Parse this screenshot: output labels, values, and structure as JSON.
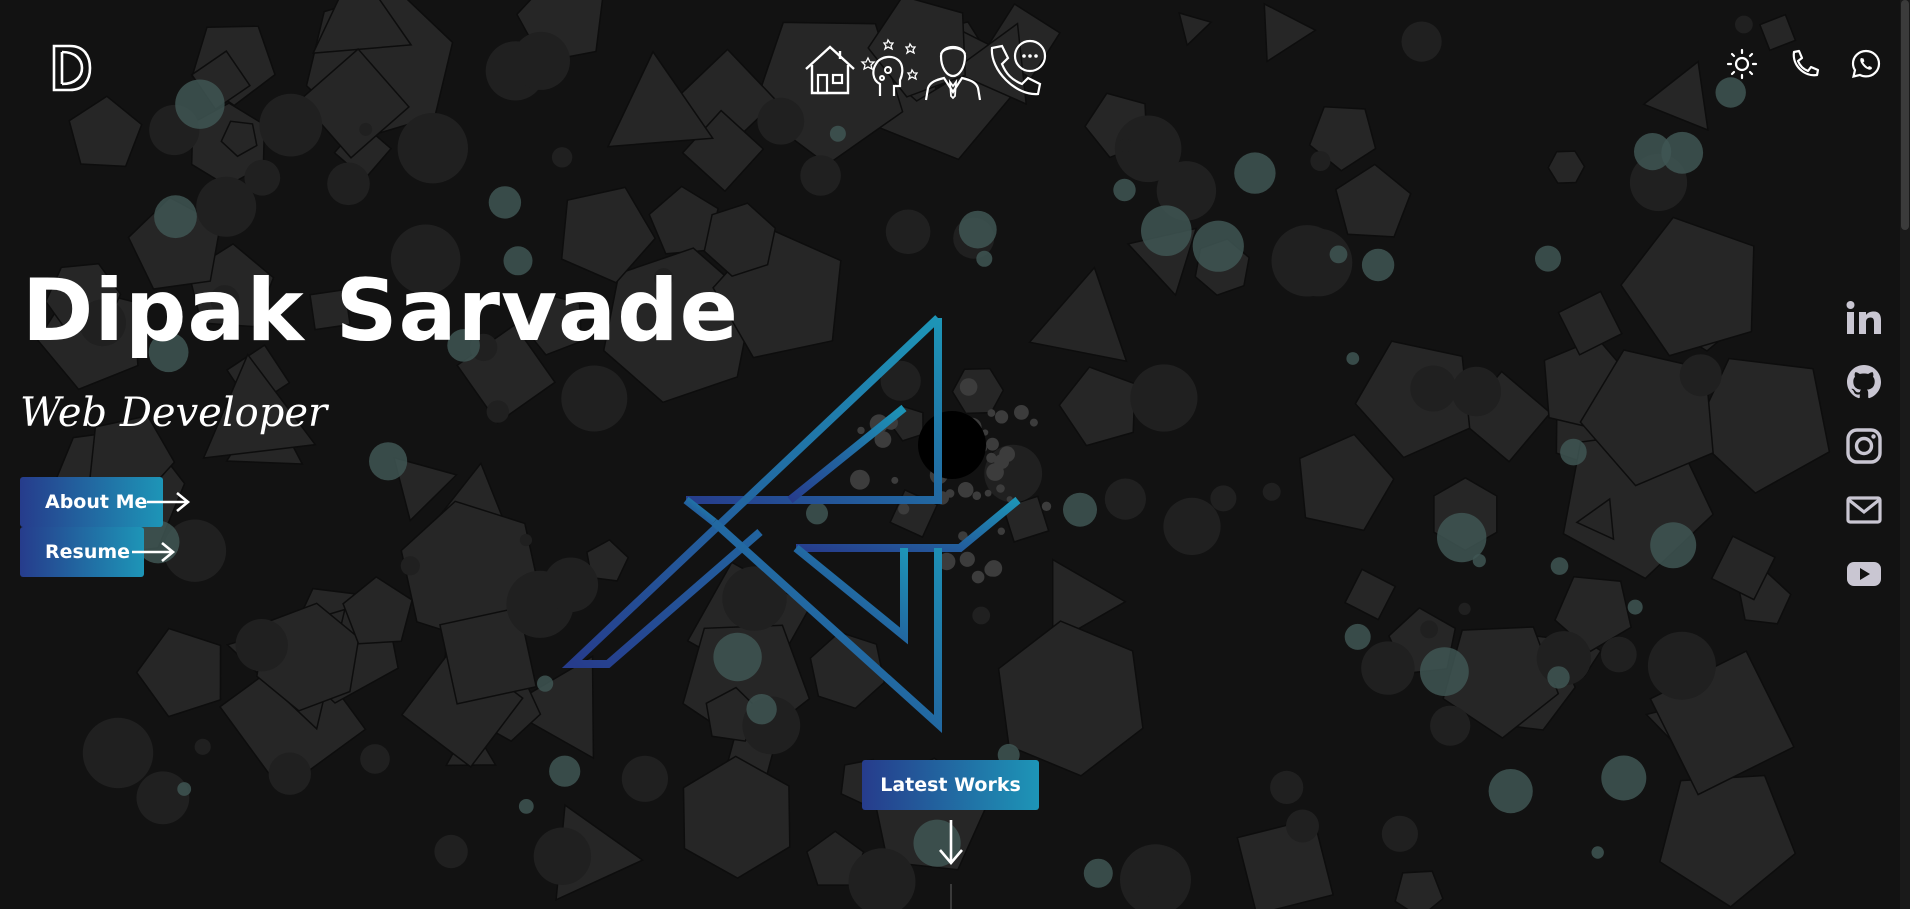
{
  "theme": {
    "background": "#121212",
    "shape_fill": "#262626",
    "bubble_fill": "#3f5653",
    "accent_start": "#263c8c",
    "accent_end": "#1d95b7",
    "text": "#ffffff",
    "social_icon_color": "#c9c6d2"
  },
  "header": {
    "logo_icon": "d-logo-icon",
    "nav": [
      {
        "name": "home",
        "icon": "house-icon"
      },
      {
        "name": "about",
        "icon": "head-ideas-icon"
      },
      {
        "name": "team",
        "icon": "person-suit-icon"
      },
      {
        "name": "contact",
        "icon": "phone-chat-icon"
      }
    ],
    "actions": [
      {
        "name": "theme-toggle",
        "icon": "sun-icon"
      },
      {
        "name": "call",
        "icon": "phone-icon"
      },
      {
        "name": "whatsapp",
        "icon": "whatsapp-icon"
      }
    ]
  },
  "hero": {
    "name": "Dipak Sarvade",
    "role": "Web Developer",
    "about_button": "About Me",
    "resume_button": "Resume",
    "works_button": "Latest Works"
  },
  "social": [
    {
      "name": "linkedin",
      "icon": "linkedin-icon"
    },
    {
      "name": "github",
      "icon": "github-icon"
    },
    {
      "name": "instagram",
      "icon": "instagram-icon"
    },
    {
      "name": "email",
      "icon": "mail-icon"
    },
    {
      "name": "youtube",
      "icon": "youtube-icon"
    }
  ]
}
